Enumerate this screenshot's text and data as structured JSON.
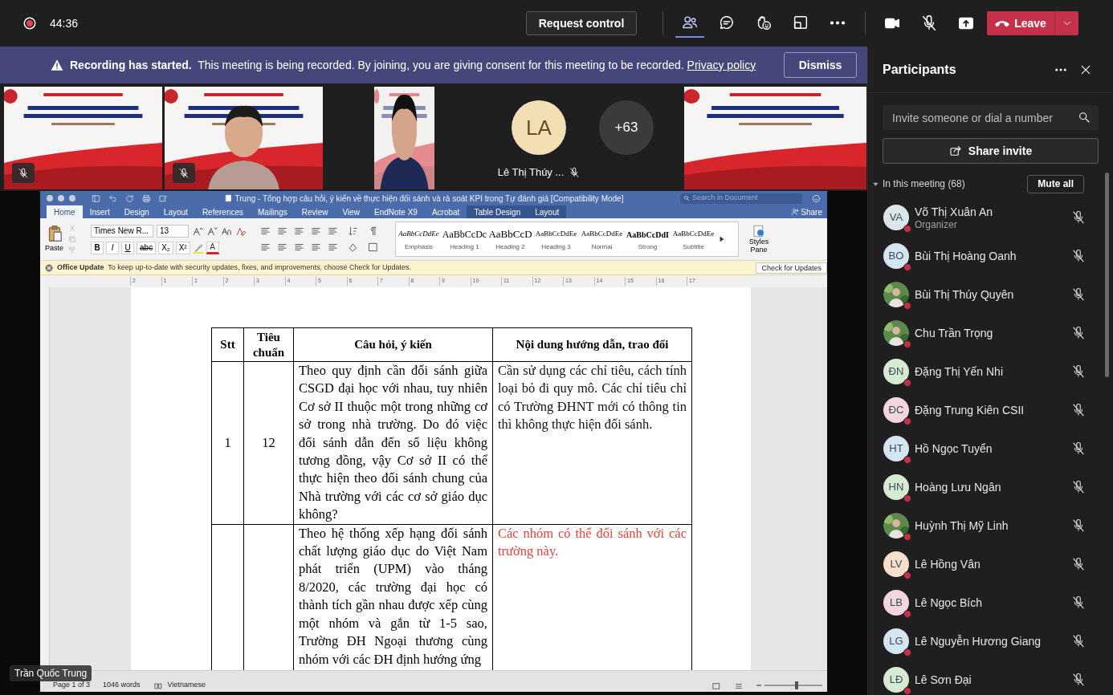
{
  "top_bar": {
    "timer": "44:36",
    "request_control": "Request control",
    "tools": [
      {
        "kind": "people",
        "selected": true
      },
      {
        "kind": "chat",
        "selected": false
      },
      {
        "kind": "reactions",
        "selected": false
      },
      {
        "kind": "rooms",
        "selected": false
      },
      {
        "kind": "more",
        "selected": false
      }
    ],
    "devices": [
      {
        "kind": "camera"
      },
      {
        "kind": "mic",
        "off": true
      },
      {
        "kind": "share"
      }
    ],
    "leave": "Leave"
  },
  "banner": {
    "title": "Recording has started.",
    "message": "This meeting is being recorded. By joining, you are giving consent for this meeting to be recorded.",
    "link": "Privacy policy",
    "button": "Dismiss"
  },
  "video_strip": [
    {
      "kind": "picture",
      "muted": true
    },
    {
      "kind": "picture",
      "muted": true
    },
    {
      "kind": "picture",
      "muted": false
    },
    {
      "kind": "avatar",
      "initials": "LA",
      "name": "Lê Thị Thúy ...",
      "muted": true
    },
    {
      "kind": "overflow",
      "count": "+63"
    },
    {
      "kind": "picture",
      "muted": false
    }
  ],
  "presenter_name": "Trần Quốc Trung",
  "word": {
    "title": "Trung - Tổng hợp câu hỏi, ý kiến về thực hiện đối sánh và rà soát KPI trong Tự đánh giá [Compatibility Mode]",
    "search_placeholder": "Search in Document",
    "share": "Share",
    "tabs": [
      {
        "label": "Home",
        "selected": true,
        "kind": "normal"
      },
      {
        "label": "Insert",
        "selected": false,
        "kind": "normal"
      },
      {
        "label": "Design",
        "selected": false,
        "kind": "normal"
      },
      {
        "label": "Layout",
        "selected": false,
        "kind": "normal"
      },
      {
        "label": "References",
        "selected": false,
        "kind": "normal"
      },
      {
        "label": "Mailings",
        "selected": false,
        "kind": "normal"
      },
      {
        "label": "Review",
        "selected": false,
        "kind": "normal"
      },
      {
        "label": "View",
        "selected": false,
        "kind": "normal"
      },
      {
        "label": "EndNote X9",
        "selected": false,
        "kind": "normal"
      },
      {
        "label": "Acrobat",
        "selected": false,
        "kind": "normal"
      },
      {
        "label": "Table Design",
        "selected": false,
        "kind": "contextual"
      },
      {
        "label": "Layout",
        "selected": false,
        "kind": "contextual"
      }
    ],
    "paste": "Paste",
    "font": "Times New R...",
    "size": "13",
    "format_buttons": [
      "B",
      "I",
      "U",
      "abc",
      "X₂",
      "X²"
    ],
    "font_color": "A",
    "styles": [
      {
        "sample": "AaBbCcDdEe",
        "label": "Emphasis"
      },
      {
        "sample": "AaBbCcDc",
        "label": "Heading 1"
      },
      {
        "sample": "AaBbCcD",
        "label": "Heading 2"
      },
      {
        "sample": "AaBbCcDdEe",
        "label": "Heading 3"
      },
      {
        "sample": "AaBbCcDdEe",
        "label": "Normal"
      },
      {
        "sample": "AaBbCcDdI",
        "label": "Strong"
      },
      {
        "sample": "AaBbCcDdEe",
        "label": "Subtitle"
      }
    ],
    "styles_pane": "Styles Pane",
    "update_bar": {
      "title": "Office Update",
      "message": "To keep up-to-date with security updates, fixes, and improvements, choose Check for Updates.",
      "button": "Check for Updates"
    },
    "ruler": [
      "2",
      "1",
      "1",
      "2",
      "3",
      "4",
      "5",
      "6",
      "7",
      "8",
      "9",
      "10",
      "11",
      "12",
      "13",
      "14",
      "15",
      "16",
      "17"
    ],
    "table": {
      "columns": [
        "Stt",
        "Tiêu chuẩn",
        "Câu hỏi, ý kiến",
        "Nội dung hướng dẫn, trao đổi"
      ],
      "rows": [
        {
          "stt": "1",
          "standard": "12",
          "question": "Theo quy định cần đối sánh giữa CSGD đại học với nhau, tuy nhiên Cơ sở II thuộc một trong những cơ sở trong nhà trường. Do đó việc đối sánh dẫn đến số liệu không tương đồng, vậy Cơ sở II có thể thực hiện theo đối sánh chung của Nhà trường với các cơ sở giáo dục không?",
          "answer": "Cần sử dụng các chỉ tiêu, cách tính loại bỏ đi quy mô. Các chỉ tiêu chỉ có Trường ĐHNT mới có thông tin thì không thực hiện đối sánh.",
          "color": "#111111"
        },
        {
          "stt": "",
          "standard": "",
          "question": "Theo hệ thống xếp hạng đối sánh chất lượng giáo dục do Việt Nam phát triển (UPM) vào tháng 8/2020, các trường đại học có thành tích gần nhau được xếp cùng một nhóm và gắn từ 1-5 sao, Trường ĐH Ngoại thương cùng nhóm với các ĐH định hướng ứng",
          "answer": "Các nhóm có thể đối sánh với các trường này.",
          "color": "#e0443b"
        }
      ]
    },
    "status": [
      "Page 1 of 3",
      "1046 words",
      "Vietnamese"
    ],
    "zoom": {
      "level": 0.55
    }
  },
  "participants": {
    "title": "Participants",
    "search_placeholder": "Invite someone or dial a number",
    "share_invite": "Share invite",
    "section": {
      "label": "In this meeting (68)",
      "expanded": true
    },
    "mute_all": "Mute all",
    "people": [
      {
        "name": "Võ Thị Xuân An",
        "role": "Organizer",
        "kind": "initials",
        "initials": "VA",
        "color": "#dbe6ec",
        "muted": true
      },
      {
        "name": "Bùi Thị Hoàng Oanh",
        "kind": "initials",
        "initials": "BO",
        "color": "#d3e6f2",
        "muted": true
      },
      {
        "name": "Bùi Thị Thúy Quyên",
        "muted": true
      },
      {
        "name": "Chu Trần Trọng",
        "muted": true
      },
      {
        "name": "Đặng Thị Yến Nhi",
        "kind": "initials",
        "initials": "ĐN",
        "color": "#d6ecd2",
        "muted": true
      },
      {
        "name": "Đặng Trung Kiên CSII",
        "kind": "initials",
        "initials": "ĐC",
        "color": "#f3d6e0",
        "muted": true
      },
      {
        "name": "Hồ Ngọc Tuyển",
        "kind": "initials",
        "initials": "HT",
        "color": "#d3e6f2",
        "muted": true
      },
      {
        "name": "Hoàng Lưu Ngân",
        "kind": "initials",
        "initials": "HN",
        "color": "#d6ecd2",
        "muted": true
      },
      {
        "name": "Huỳnh Thị Mỹ Linh",
        "muted": true
      },
      {
        "name": "Lê Hồng Vân",
        "kind": "initials",
        "initials": "LV",
        "color": "#f6e0cc",
        "muted": true
      },
      {
        "name": "Lê Ngọc Bích",
        "kind": "initials",
        "initials": "LB",
        "color": "#f3d6e0",
        "muted": true
      },
      {
        "name": "Lê Nguyễn Hương Giang",
        "kind": "initials",
        "initials": "LG",
        "color": "#d3e6f2",
        "muted": true
      },
      {
        "name": "Lê Sơn Đại",
        "kind": "initials",
        "initials": "LĐ",
        "color": "#d6ecd2",
        "muted": true
      }
    ]
  }
}
